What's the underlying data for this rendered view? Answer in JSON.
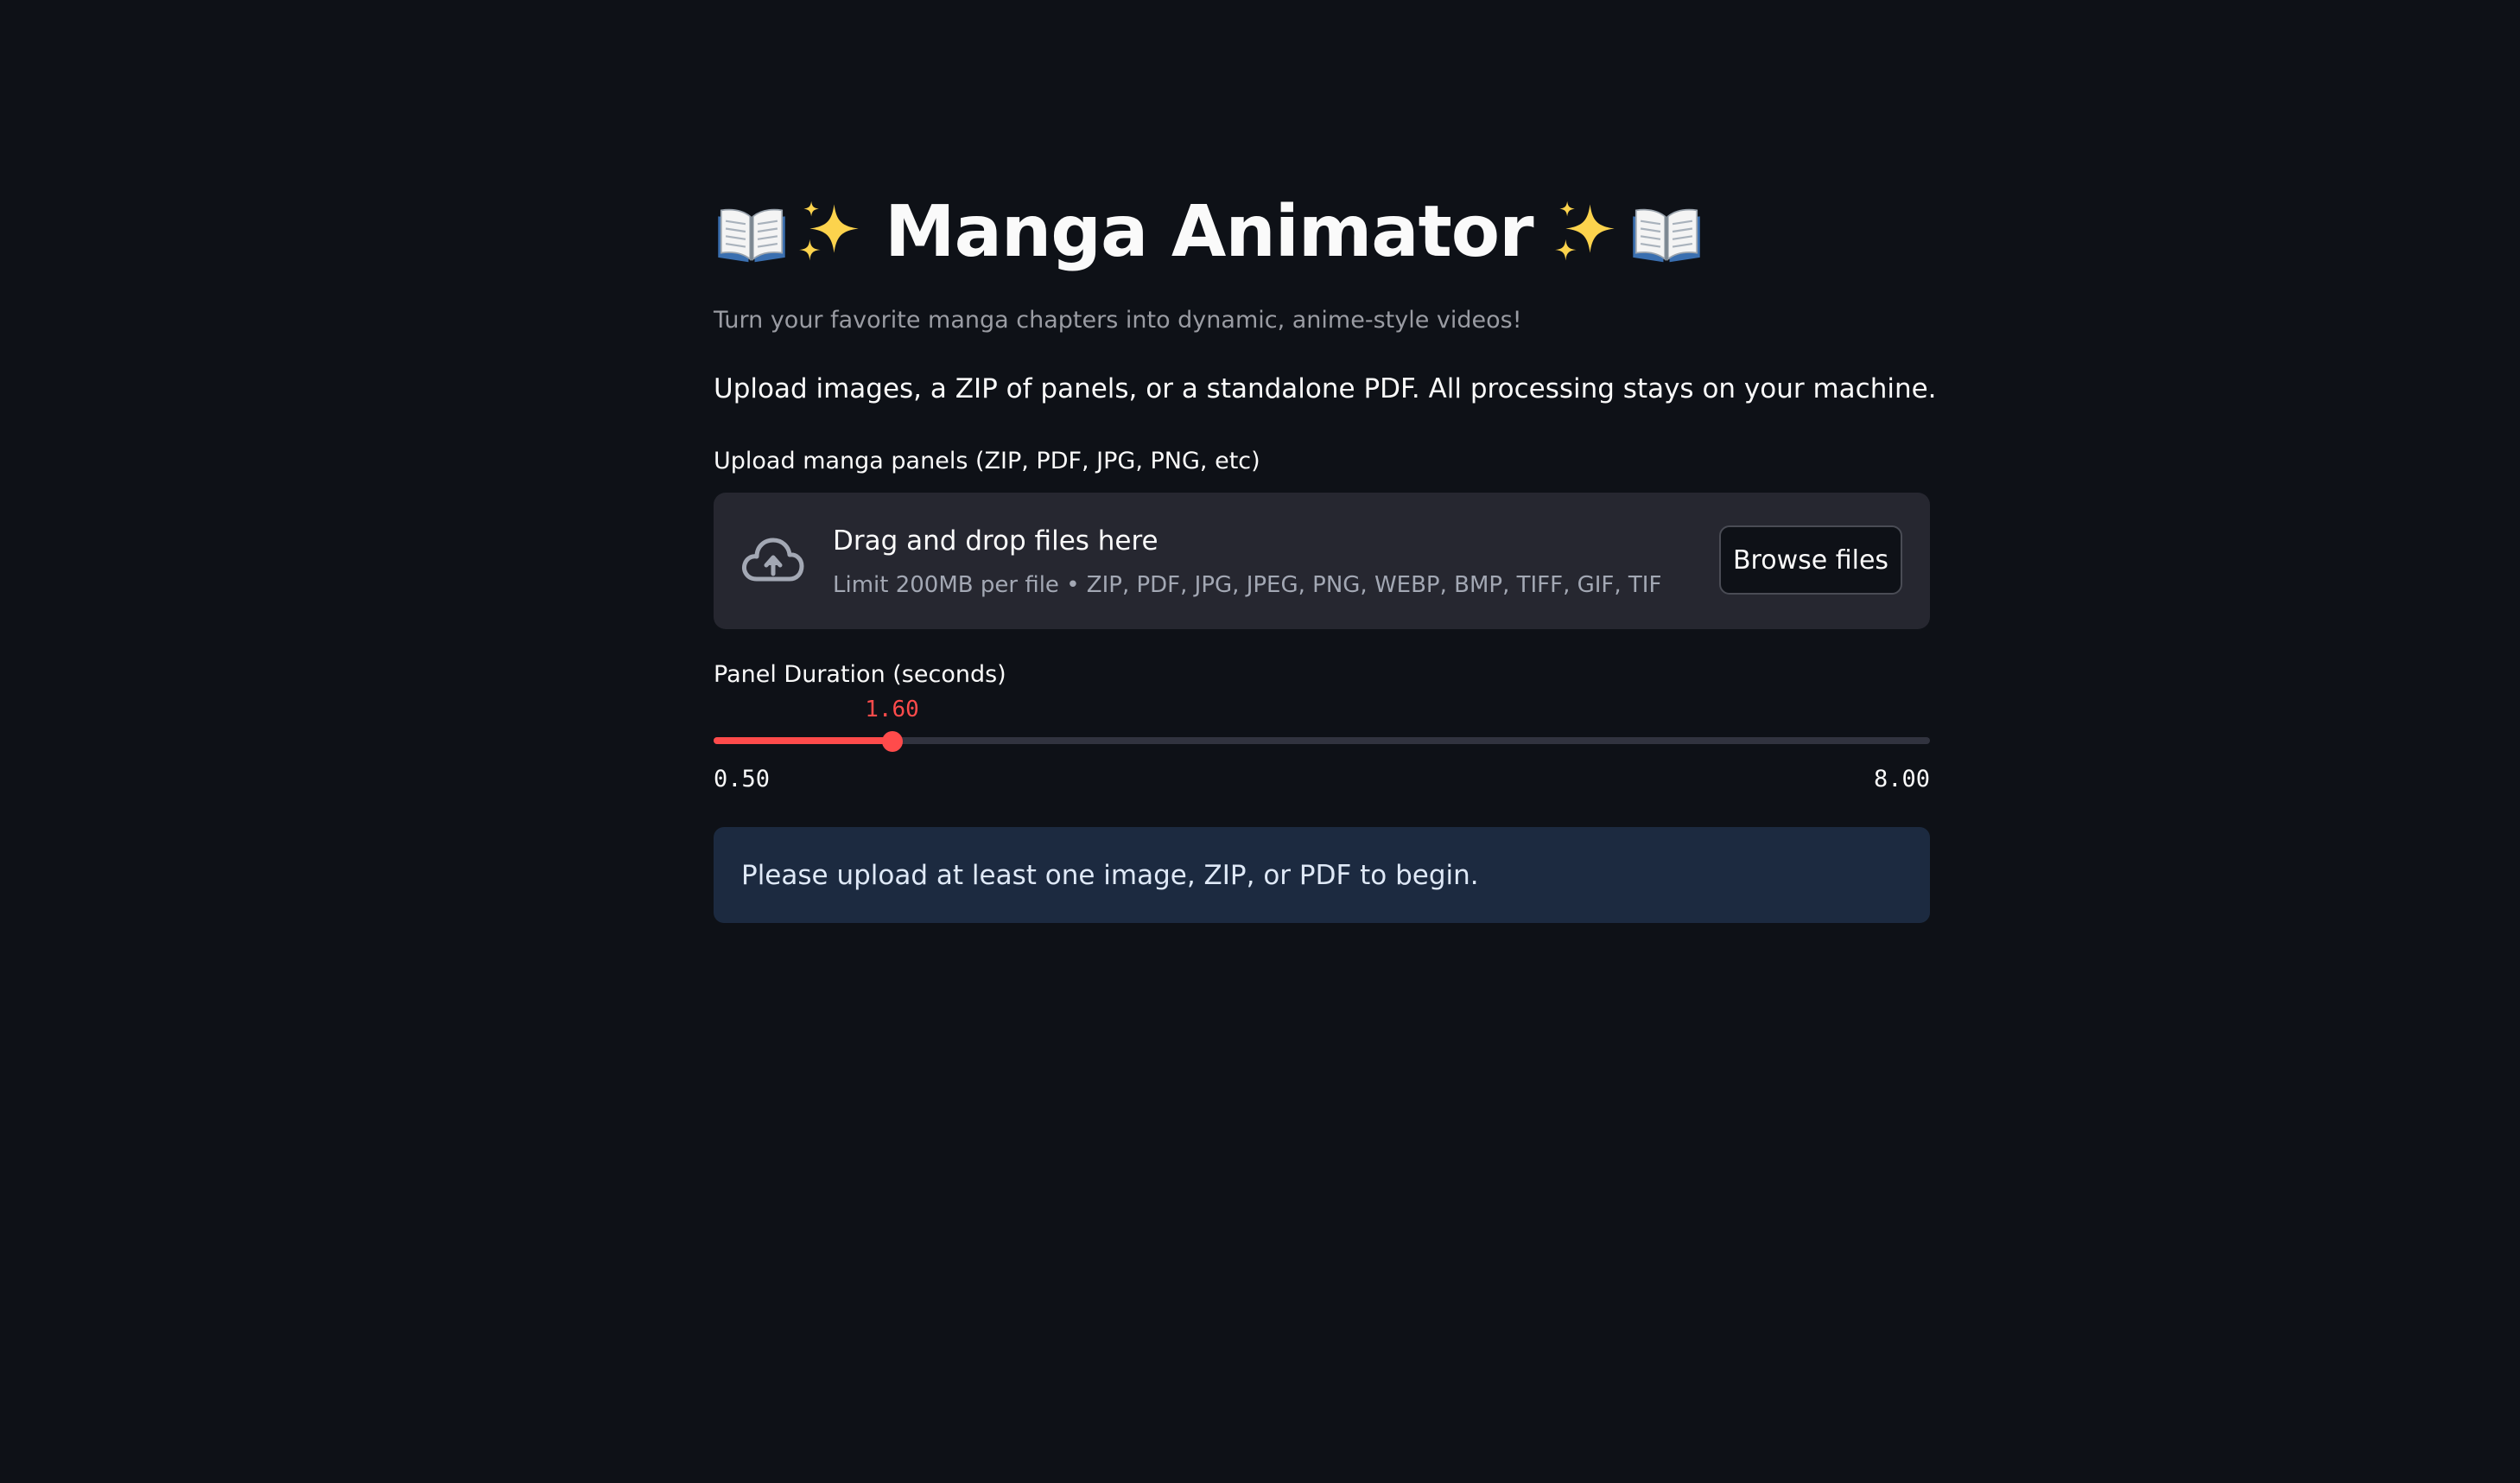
{
  "header": {
    "title": "Manga Animator",
    "caption": "Turn your favorite manga chapters into dynamic, anime-style videos!",
    "intro": "Upload images, a ZIP of panels, or a standalone PDF. All processing stays on your machine."
  },
  "uploader": {
    "label": "Upload manga panels (ZIP, PDF, JPG, PNG, etc)",
    "drop_title": "Drag and drop files here",
    "limit_text": "Limit 200MB per file • ZIP, PDF, JPG, JPEG, PNG, WEBP, BMP, TIFF, GIF, TIF",
    "browse_label": "Browse files",
    "icon": "cloud-upload-icon"
  },
  "slider": {
    "label": "Panel Duration (seconds)",
    "value": 1.6,
    "value_text": "1.60",
    "min": 0.5,
    "max": 8.0,
    "min_text": "0.50",
    "max_text": "8.00"
  },
  "info": {
    "message": "Please upload at least one image, ZIP, or PDF to begin."
  },
  "icons": {
    "title_left": [
      "open-book-icon",
      "sparkles-icon"
    ],
    "title_right": [
      "sparkles-icon",
      "open-book-icon"
    ]
  },
  "colors": {
    "background": "#0e1117",
    "accent": "#ff4b4b",
    "uploader_bg": "#262730",
    "info_bg": "#1c2a40"
  }
}
